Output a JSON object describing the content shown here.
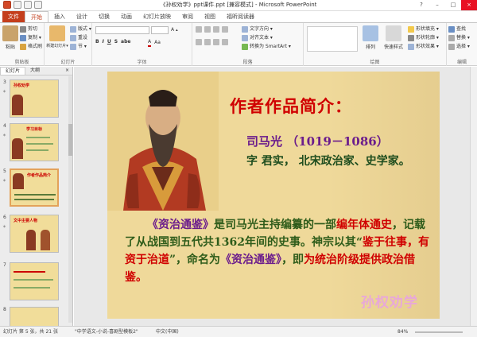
{
  "window": {
    "title": "《孙权劝学》ppt课件.ppt [兼容模式] - Microsoft PowerPoint"
  },
  "tabs": [
    "文件",
    "开始",
    "插入",
    "设计",
    "切换",
    "动画",
    "幻灯片放映",
    "审阅",
    "视图",
    "福昕阅读器"
  ],
  "ribbon": {
    "clipboard": {
      "paste": "粘贴",
      "cut": "剪切",
      "copy": "复制 ▾",
      "format_painter": "格式刷",
      "name": "剪贴板"
    },
    "slides": {
      "new_slide": "新建幻灯片▾",
      "layout": "版式 ▾",
      "reset": "重设",
      "section": "节 ▾",
      "name": "幻灯片"
    },
    "font": {
      "name": "字体"
    },
    "paragraph": {
      "text_direction": "文字方向 ▾",
      "align_text": "对齐文本 ▾",
      "smartart": "转换为 SmartArt ▾",
      "name": "段落"
    },
    "drawing": {
      "arrange": "排列",
      "quick_styles": "快速样式",
      "shape_fill": "形状填充 ▾",
      "shape_outline": "形状轮廓 ▾",
      "shape_effects": "形状效果 ▾",
      "name": "绘图"
    },
    "editing": {
      "find": "查找",
      "replace": "替换 ▾",
      "select": "选择 ▾",
      "name": "编辑"
    }
  },
  "panel": {
    "tab_slides": "幻灯片",
    "tab_outline": "大纲",
    "close": "×",
    "thumbs": [
      {
        "num": "3",
        "title": "孙权劝学"
      },
      {
        "num": "4",
        "title": "学习目标"
      },
      {
        "num": "5",
        "title": "作者作品简介"
      },
      {
        "num": "6",
        "title": "文中主要人物"
      },
      {
        "num": "7",
        "title": ""
      },
      {
        "num": "8",
        "title": ""
      }
    ]
  },
  "slide": {
    "heading": "作者作品简介：",
    "author": "司马光 （1019－1086）",
    "desc": "字 君实， 北宋政治家、史学家。",
    "para_segments": [
      {
        "t": "《资治通鉴》",
        "c": "b"
      },
      {
        "t": "是司马光主持编纂的一部",
        "c": ""
      },
      {
        "t": "编年体通史",
        "c": "r"
      },
      {
        "t": "，记载了从战国到五代共1362年间的史事。神宗以其“",
        "c": ""
      },
      {
        "t": "鉴于往事，有资于治道",
        "c": "r"
      },
      {
        "t": "”，命名为",
        "c": ""
      },
      {
        "t": "《资治通鉴》",
        "c": "b"
      },
      {
        "t": "，即",
        "c": ""
      },
      {
        "t": "为统治阶级提供政治借鉴。",
        "c": "r"
      }
    ],
    "corner_title": "孙权劝学"
  },
  "status": {
    "slide_info": "幻灯片 第 5 张，共 21 张",
    "theme": "\"中学语文-小说-喜剧型模板2\"",
    "language": "中文(中国)",
    "zoom": "84%"
  },
  "colors": {
    "accent": "#c43e1c",
    "slide_bg": "#efd99a",
    "heading": "#d00000"
  }
}
